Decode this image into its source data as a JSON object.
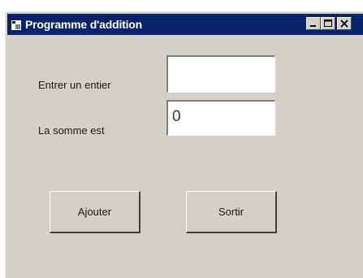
{
  "window": {
    "title": "Programme d'addition",
    "controls": {
      "minimize_icon": "minimize-icon",
      "maximize_icon": "maximize-icon",
      "close_icon": "close-icon"
    }
  },
  "form": {
    "entier_label": "Entrer un entier",
    "entier_value": "",
    "somme_label": "La somme est",
    "somme_value": "0"
  },
  "buttons": {
    "ajouter_label": "Ajouter",
    "sortir_label": "Sortir"
  },
  "colors": {
    "titlebar": "#0a246a",
    "window_face": "#d4d0c8"
  }
}
